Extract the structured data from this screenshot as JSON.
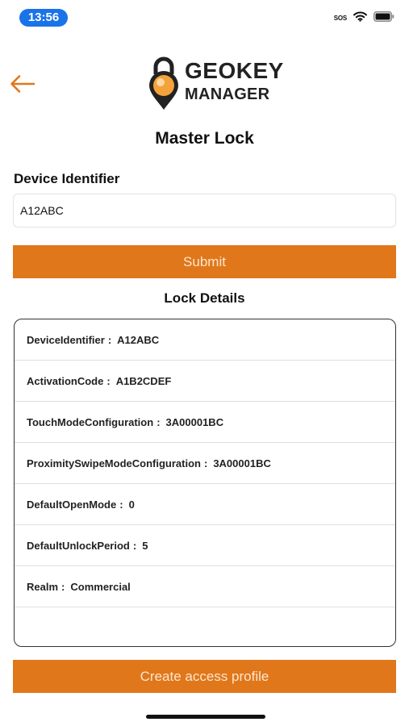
{
  "status_bar": {
    "time": "13:56",
    "sos": "SOS"
  },
  "header": {
    "logo": {
      "line1": "GEOKEY",
      "line2": "MANAGER"
    },
    "title": "Master Lock"
  },
  "device_form": {
    "label": "Device Identifier",
    "value": "A12ABC",
    "submit_label": "Submit"
  },
  "lock_details": {
    "title": "Lock Details",
    "separator": ":",
    "rows": [
      {
        "key": "DeviceIdentifier",
        "value": "A12ABC"
      },
      {
        "key": "ActivationCode",
        "value": "A1B2CDEF"
      },
      {
        "key": "TouchModeConfiguration",
        "value": "3A00001BC"
      },
      {
        "key": "ProximitySwipeModeConfiguration",
        "value": "3A00001BC"
      },
      {
        "key": "DefaultOpenMode",
        "value": "0"
      },
      {
        "key": "DefaultUnlockPeriod",
        "value": "5"
      },
      {
        "key": "Realm",
        "value": "Commercial"
      }
    ]
  },
  "footer": {
    "create_label": "Create access profile"
  },
  "colors": {
    "accent": "#e0771a",
    "status_pill": "#1a73e8",
    "button_text": "#fde6cf"
  },
  "icons": {
    "back": "arrow-left-icon",
    "logo": "padlock-pin-icon",
    "signal": "signal-icon",
    "wifi": "wifi-icon",
    "battery": "battery-icon"
  }
}
